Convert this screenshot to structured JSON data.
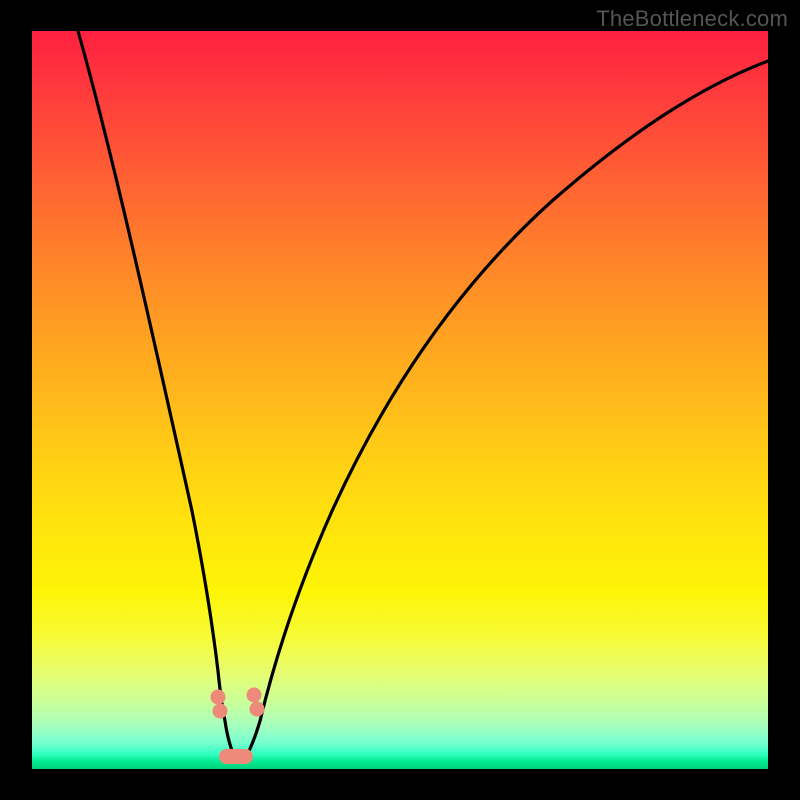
{
  "watermark": "TheBottleneck.com",
  "chart_data": {
    "type": "line",
    "title": "",
    "xlabel": "",
    "ylabel": "",
    "xlim": [
      0,
      100
    ],
    "ylim": [
      0,
      100
    ],
    "note": "No axis ticks or numeric labels are visible; values are pixel-fraction estimates (0–100) read off the plot area. y=0 is bottom (green, low bottleneck), y=100 is top (red, high bottleneck). The curve has a sharp V-shaped minimum near x≈27 reaching y≈2, with a steep left branch and a gentler right branch.",
    "series": [
      {
        "name": "bottleneck-curve",
        "x": [
          6,
          10,
          14,
          18,
          21,
          23.5,
          25.5,
          27,
          29,
          31,
          34,
          38,
          44,
          52,
          62,
          74,
          88,
          100
        ],
        "y": [
          100,
          80,
          60,
          40,
          24,
          12,
          5,
          2,
          4,
          8,
          16,
          27,
          40,
          53,
          65,
          75,
          82,
          86
        ]
      }
    ],
    "markers": [
      {
        "name": "left-pink-marker",
        "x": 25.0,
        "y": 7.5
      },
      {
        "name": "right-pink-marker",
        "x": 30.0,
        "y": 7.5
      },
      {
        "name": "bottom-pink-marker",
        "x": 27.5,
        "y": 2.0
      }
    ],
    "gradient_stops": [
      {
        "pos": 0,
        "color": "#ff2040"
      },
      {
        "pos": 50,
        "color": "#ffc018"
      },
      {
        "pos": 80,
        "color": "#fbf720"
      },
      {
        "pos": 100,
        "color": "#00d37a"
      }
    ]
  }
}
